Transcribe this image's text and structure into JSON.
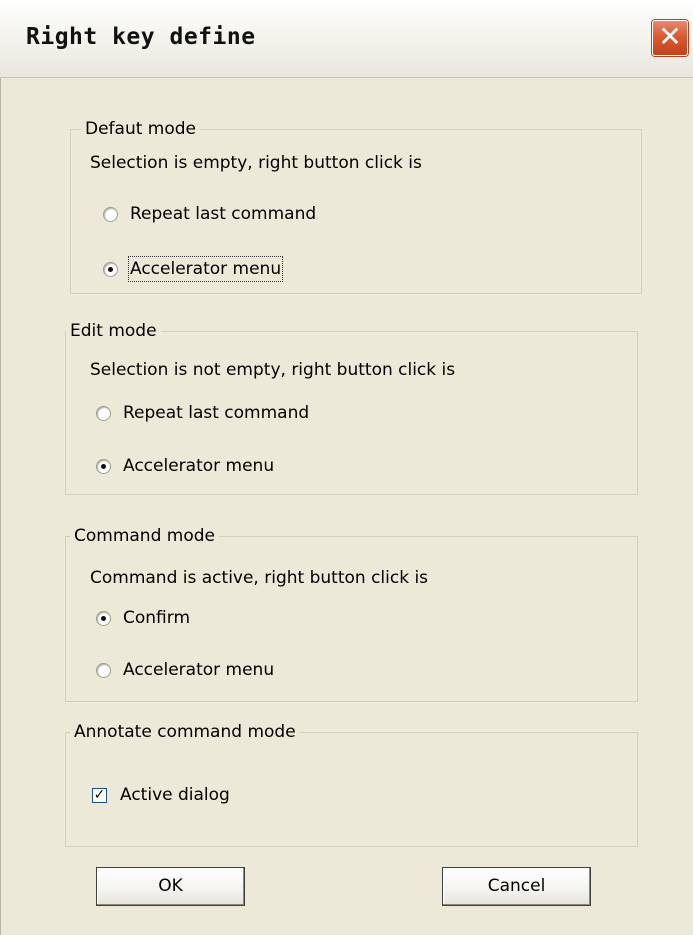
{
  "window": {
    "title": "Right key define",
    "close_glyph": "✕"
  },
  "groups": [
    {
      "legend": "Defaut mode",
      "description": "Selection is empty, right button click is",
      "options": [
        {
          "label": "Repeat last command",
          "checked": false
        },
        {
          "label": "Accelerator menu",
          "checked": true
        }
      ]
    },
    {
      "legend": "Edit mode",
      "description": "Selection is not empty, right button click is",
      "options": [
        {
          "label": "Repeat last command",
          "checked": false
        },
        {
          "label": "Accelerator menu",
          "checked": true
        }
      ]
    },
    {
      "legend": "Command mode",
      "description": "Command is active, right button click is",
      "options": [
        {
          "label": "Confirm",
          "checked": true
        },
        {
          "label": "Accelerator menu",
          "checked": false
        }
      ]
    },
    {
      "legend": "Annotate command mode",
      "checkbox": {
        "label": "Active dialog",
        "checked": true,
        "glyph": "✓"
      }
    }
  ],
  "buttons": {
    "ok": "OK",
    "cancel": "Cancel"
  }
}
